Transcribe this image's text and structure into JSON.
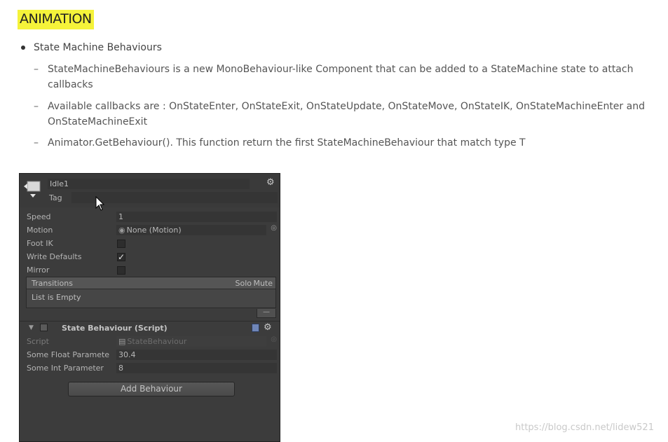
{
  "slide": {
    "heading": "ANIMATION",
    "bullet": "State Machine Behaviours",
    "sub_bullets": [
      "StateMachineBehaviours is a new MonoBehaviour-like Component that can be added to a StateMachine state to attach callbacks",
      "Available callbacks are : OnStateEnter, OnStateExit, OnStateUpdate, OnStateMove, OnStateIK, OnStateMachineEnter and OnStateMachineExit",
      "Animator.GetBehaviour(). This function return the first StateMachineBehaviour that match type T"
    ]
  },
  "inspector": {
    "state_name": "Idle1",
    "tag_label": "Tag",
    "tag_value": "",
    "fields": {
      "speed_label": "Speed",
      "speed_value": "1",
      "motion_label": "Motion",
      "motion_value": "None (Motion)",
      "foot_ik_label": "Foot IK",
      "foot_ik_checked": false,
      "write_defaults_label": "Write Defaults",
      "write_defaults_checked": true,
      "mirror_label": "Mirror",
      "mirror_checked": false
    },
    "transitions": {
      "title": "Transitions",
      "solo": "Solo",
      "mute": "Mute",
      "empty_text": "List is Empty",
      "remove_symbol": "—"
    },
    "behaviour": {
      "title": "State Behaviour (Script)",
      "script_label": "Script",
      "script_value": "StateBehaviour",
      "float_label": "Some Float Paramete",
      "float_value": "30.4",
      "int_label": "Some Int Parameter",
      "int_value": "8"
    },
    "add_button": "Add Behaviour",
    "checkmark": "✓",
    "gear_glyph": "⚙"
  },
  "watermark": "https://blog.csdn.net/lidew521",
  "colors": {
    "highlight": "#f5f33a",
    "panel_bg": "#3c3c3c",
    "field_bg": "#353535",
    "panel_text": "#b4b4b4"
  }
}
